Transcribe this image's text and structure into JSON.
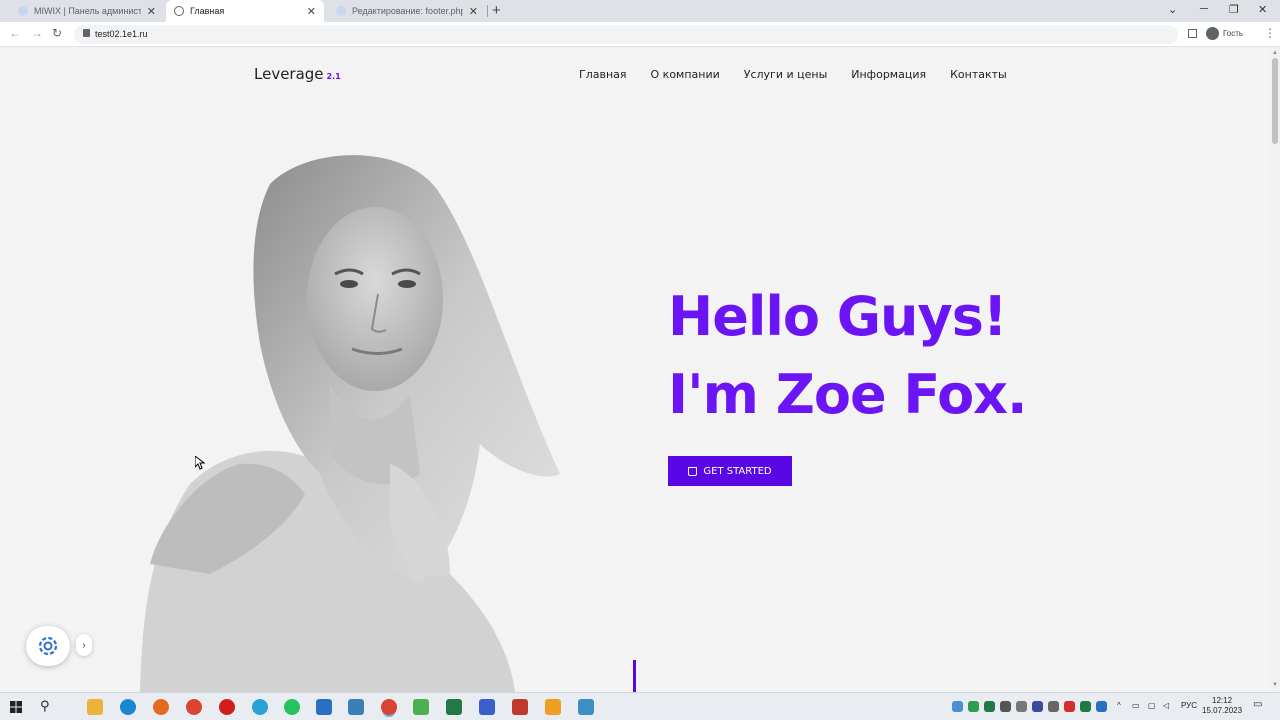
{
  "browser": {
    "tabs": [
      {
        "title": "MIWIX | Панель администратора",
        "active": false
      },
      {
        "title": "Главная",
        "active": true
      },
      {
        "title": "Редактирование: footer.php",
        "active": false
      }
    ],
    "url": "test02.1e1.ru",
    "profile_label": "Гость"
  },
  "site": {
    "logo": "Leverage",
    "logo_version": "2.1",
    "nav": [
      "Главная",
      "О компании",
      "Услуги и цены",
      "Информация",
      "Контакты"
    ],
    "hero_line1": "Hello Guys!",
    "hero_line2": "I'm Zoe Fox.",
    "cta_label": "GET STARTED",
    "accent_color": "#6610f2"
  },
  "taskbar": {
    "language": "РУС",
    "time": "12:12",
    "date": "15.07.2023"
  }
}
